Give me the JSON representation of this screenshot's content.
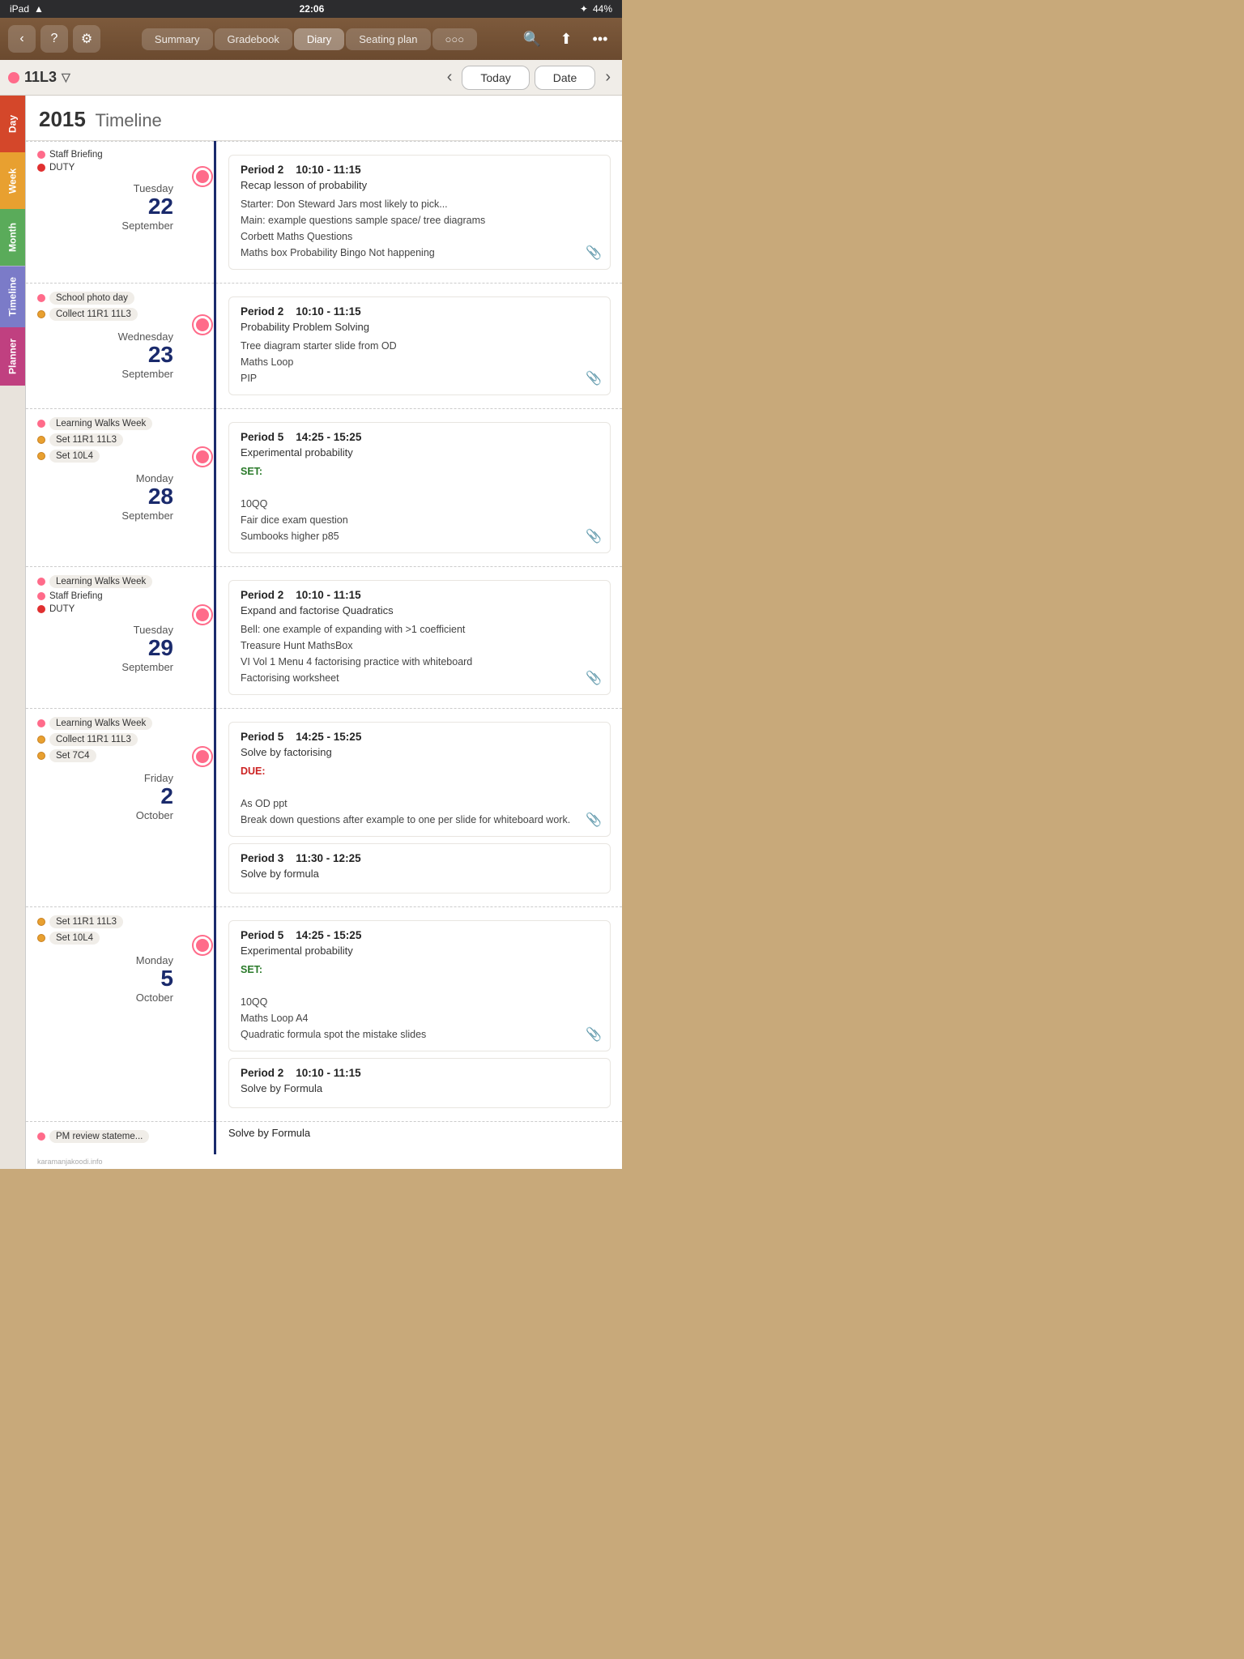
{
  "statusBar": {
    "left": "iPad",
    "wifi": "wifi",
    "time": "22:06",
    "bluetooth": "bluetooth",
    "battery": "44%"
  },
  "toolbar": {
    "backLabel": "‹",
    "helpLabel": "?",
    "settingsLabel": "⚙",
    "tabs": [
      {
        "label": "Summary",
        "active": false
      },
      {
        "label": "Gradebook",
        "active": false
      },
      {
        "label": "Diary",
        "active": true
      },
      {
        "label": "Seating plan",
        "active": false
      },
      {
        "label": "○○○",
        "active": false
      }
    ],
    "searchLabel": "🔍",
    "shareLabel": "⬆",
    "moreLabel": "•••"
  },
  "navBar": {
    "className": "11L3",
    "filterIcon": "▽",
    "prevLabel": "‹",
    "nextLabel": "›",
    "todayLabel": "Today",
    "dateLabel": "Date"
  },
  "yearHeader": {
    "year": "2015",
    "label": "Timeline"
  },
  "sideTabs": [
    {
      "label": "Day",
      "key": "day"
    },
    {
      "label": "Week",
      "key": "week"
    },
    {
      "label": "Month",
      "key": "month"
    },
    {
      "label": "Timeline",
      "key": "timeline"
    },
    {
      "label": "Planner",
      "key": "planner"
    }
  ],
  "sections": [
    {
      "date": {
        "dayName": "Tuesday",
        "dayNum": "22",
        "month": "September"
      },
      "leftEvents": [
        {
          "dot": "pink",
          "label": "Staff Briefing",
          "hasBox": false
        },
        {
          "dot": "red",
          "label": "DUTY",
          "hasBox": false
        }
      ],
      "rightCards": [
        {
          "period": "Period 2",
          "time": "10:10 - 11:15",
          "desc": "Recap lesson of probability",
          "details": "Starter: Don Steward Jars most likely to pick...\nMain: example questions sample space/ tree diagrams\nCorbett Maths Questions\nMaths box Probability Bingo Not happening",
          "labelType": null,
          "labelText": null,
          "hasAttachment": true
        }
      ]
    },
    {
      "date": {
        "dayName": "Wednesday",
        "dayNum": "23",
        "month": "September"
      },
      "leftEvents": [
        {
          "dot": "pink",
          "label": "School photo day",
          "hasBox": true
        },
        {
          "dot": "orange",
          "label": "Collect 11R1 11L3",
          "hasBox": true
        }
      ],
      "rightCards": [
        {
          "period": "Period 2",
          "time": "10:10 - 11:15",
          "desc": "Probability Problem Solving",
          "details": "Tree diagram starter slide from OD\nMaths Loop\nPIP",
          "labelType": null,
          "labelText": null,
          "hasAttachment": true
        }
      ]
    },
    {
      "date": {
        "dayName": "Monday",
        "dayNum": "28",
        "month": "September"
      },
      "leftEvents": [
        {
          "dot": "pink",
          "label": "Learning Walks Week",
          "hasBox": true
        },
        {
          "dot": "orange",
          "label": "Set 11R1 11L3",
          "hasBox": true
        },
        {
          "dot": "orange",
          "label": "Set 10L4",
          "hasBox": true
        }
      ],
      "rightCards": [
        {
          "period": "Period 5",
          "time": "14:25 - 15:25",
          "desc": "Experimental probability",
          "details": "SET:\n\n10QQ\nFair dice exam question\nSumbooks higher p85",
          "labelType": "green",
          "labelText": "SET:",
          "hasAttachment": true
        }
      ]
    },
    {
      "date": {
        "dayName": "Tuesday",
        "dayNum": "29",
        "month": "September"
      },
      "leftEvents": [
        {
          "dot": "pink",
          "label": "Learning Walks Week",
          "hasBox": true
        },
        {
          "dot": "pink",
          "label": "Staff Briefing",
          "hasBox": false
        },
        {
          "dot": "red",
          "label": "DUTY",
          "hasBox": false
        }
      ],
      "rightCards": [
        {
          "period": "Period 2",
          "time": "10:10 - 11:15",
          "desc": "Expand and factorise Quadratics",
          "details": "Bell: one example of expanding with >1 coefficient\nTreasure Hunt MathsBox\nVI Vol 1 Menu 4 factorising practice with whiteboard\nFactorising worksheet",
          "labelType": null,
          "labelText": null,
          "hasAttachment": true
        }
      ]
    },
    {
      "date": {
        "dayName": "Friday",
        "dayNum": "2",
        "month": "October"
      },
      "leftEvents": [
        {
          "dot": "pink",
          "label": "Learning Walks Week",
          "hasBox": true
        },
        {
          "dot": "orange",
          "label": "Collect 11R1 11L3",
          "hasBox": true
        },
        {
          "dot": "orange",
          "label": "Set 7C4",
          "hasBox": true
        }
      ],
      "rightCards": [
        {
          "period": "Period 5",
          "time": "14:25 - 15:25",
          "desc": "Solve by factorising",
          "details": "As OD ppt\nBreak down questions after example to one per slide for whiteboard work.",
          "labelType": "red",
          "labelText": "DUE:",
          "hasAttachment": true
        },
        {
          "period": "Period 3",
          "time": "11:30 - 12:25",
          "desc": "Solve by formula",
          "details": null,
          "labelType": null,
          "labelText": null,
          "hasAttachment": false
        }
      ]
    },
    {
      "date": {
        "dayName": "Monday",
        "dayNum": "5",
        "month": "October"
      },
      "leftEvents": [
        {
          "dot": "orange",
          "label": "Set 11R1 11L3",
          "hasBox": true
        },
        {
          "dot": "orange",
          "label": "Set 10L4",
          "hasBox": true
        }
      ],
      "rightCards": [
        {
          "period": "Period 5",
          "time": "14:25 - 15:25",
          "desc": "Experimental probability",
          "details": "SET:\n\n10QQ\nMaths Loop A4\nQuadratic formula spot the mistake slides",
          "labelType": "green",
          "labelText": "SET:",
          "hasAttachment": true
        },
        {
          "period": "Period 2",
          "time": "10:10 - 11:15",
          "desc": "Solve by Formula",
          "details": null,
          "labelType": null,
          "labelText": null,
          "hasAttachment": false
        }
      ]
    }
  ],
  "lastLeftEvents": [
    {
      "dot": "pink",
      "label": "PM review stateme...",
      "hasBox": true
    }
  ],
  "watermark": "karamanjakoodi.info"
}
